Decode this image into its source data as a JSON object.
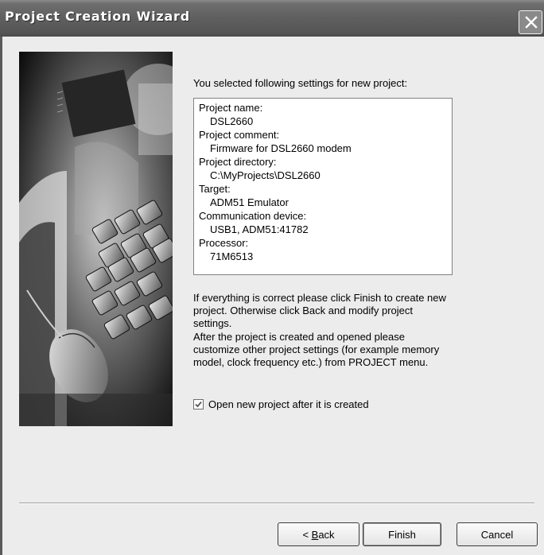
{
  "window": {
    "title": "Project Creation Wizard"
  },
  "intro": "You selected following settings for new project:",
  "summary": [
    {
      "text": "Project name:",
      "indent": false
    },
    {
      "text": "DSL2660",
      "indent": true
    },
    {
      "text": "Project comment:",
      "indent": false
    },
    {
      "text": "Firmware for DSL2660 modem",
      "indent": true
    },
    {
      "text": "Project directory:",
      "indent": false
    },
    {
      "text": "C:\\MyProjects\\DSL2660",
      "indent": true
    },
    {
      "text": "Target:",
      "indent": false
    },
    {
      "text": "ADM51 Emulator",
      "indent": true
    },
    {
      "text": "Communication device:",
      "indent": false
    },
    {
      "text": "USB1, ADM51:41782",
      "indent": true
    },
    {
      "text": "Processor:",
      "indent": false
    },
    {
      "text": "71M6513",
      "indent": true
    }
  ],
  "info": {
    "paragraph1": "If everything is correct please click Finish to create new project. Otherwise click Back and modify project settings.",
    "paragraph2": "After the project is created and opened please customize other project settings (for example memory model, clock frequency etc.) from PROJECT menu."
  },
  "open_after_create": {
    "label": "Open new project after it is created",
    "checked": true
  },
  "buttons": {
    "back_prefix": "< ",
    "back_mnemonic": "B",
    "back_rest": "ack",
    "finish": "Finish",
    "cancel": "Cancel"
  },
  "icons": {
    "close": "close-icon",
    "check": "checkmark-icon"
  }
}
